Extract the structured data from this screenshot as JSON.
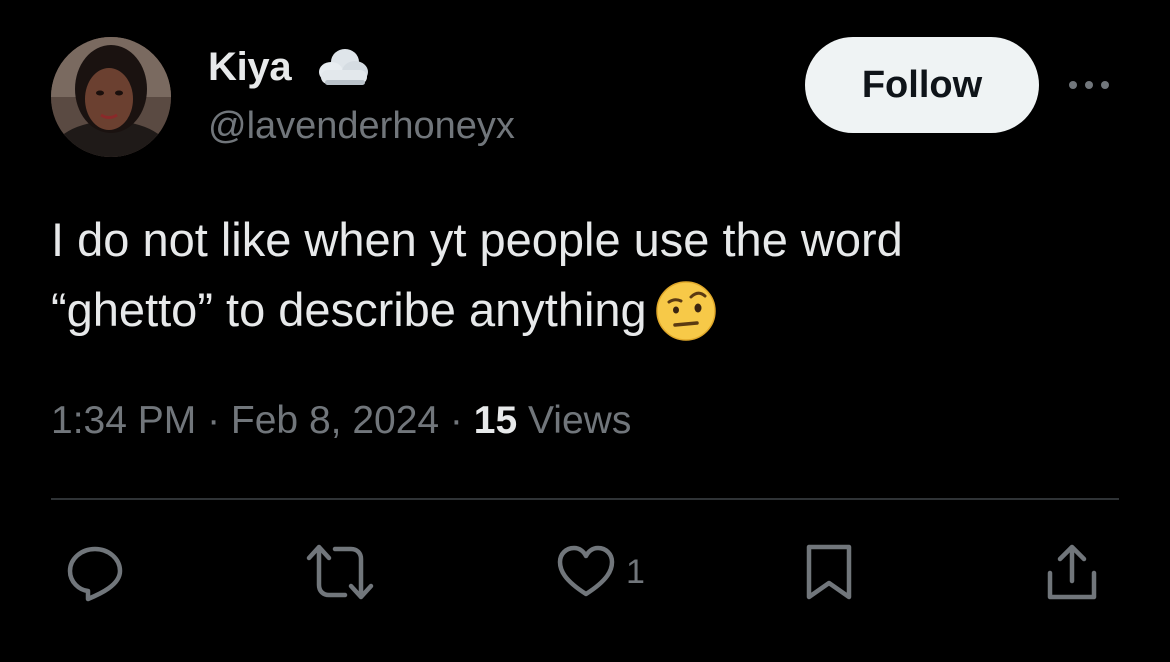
{
  "author": {
    "display_name": "Kiya",
    "name_emoji": "cloud",
    "handle": "@lavenderhoneyx",
    "avatar_icon": "user-avatar"
  },
  "follow_button": {
    "label": "Follow"
  },
  "tweet": {
    "text_line1": "I do not like when yt people use the word",
    "text_line2": "“ghetto” to describe anything",
    "emoji": "face-with-raised-eyebrow"
  },
  "meta": {
    "time": "1:34 PM",
    "sep1": " · ",
    "date": "Feb 8, 2024",
    "sep2": " · ",
    "views_count": "15",
    "views_label": " Views"
  },
  "actions": {
    "reply_icon": "reply-icon",
    "retweet_icon": "retweet-icon",
    "like_icon": "heart-icon",
    "like_count": "1",
    "bookmark_icon": "bookmark-icon",
    "share_icon": "share-icon"
  },
  "colors": {
    "background": "#000000",
    "primary_text": "#e7e9ea",
    "secondary_text": "#71767b",
    "divider": "#2f3336",
    "follow_bg": "#eff3f4",
    "follow_text": "#0f1419"
  }
}
